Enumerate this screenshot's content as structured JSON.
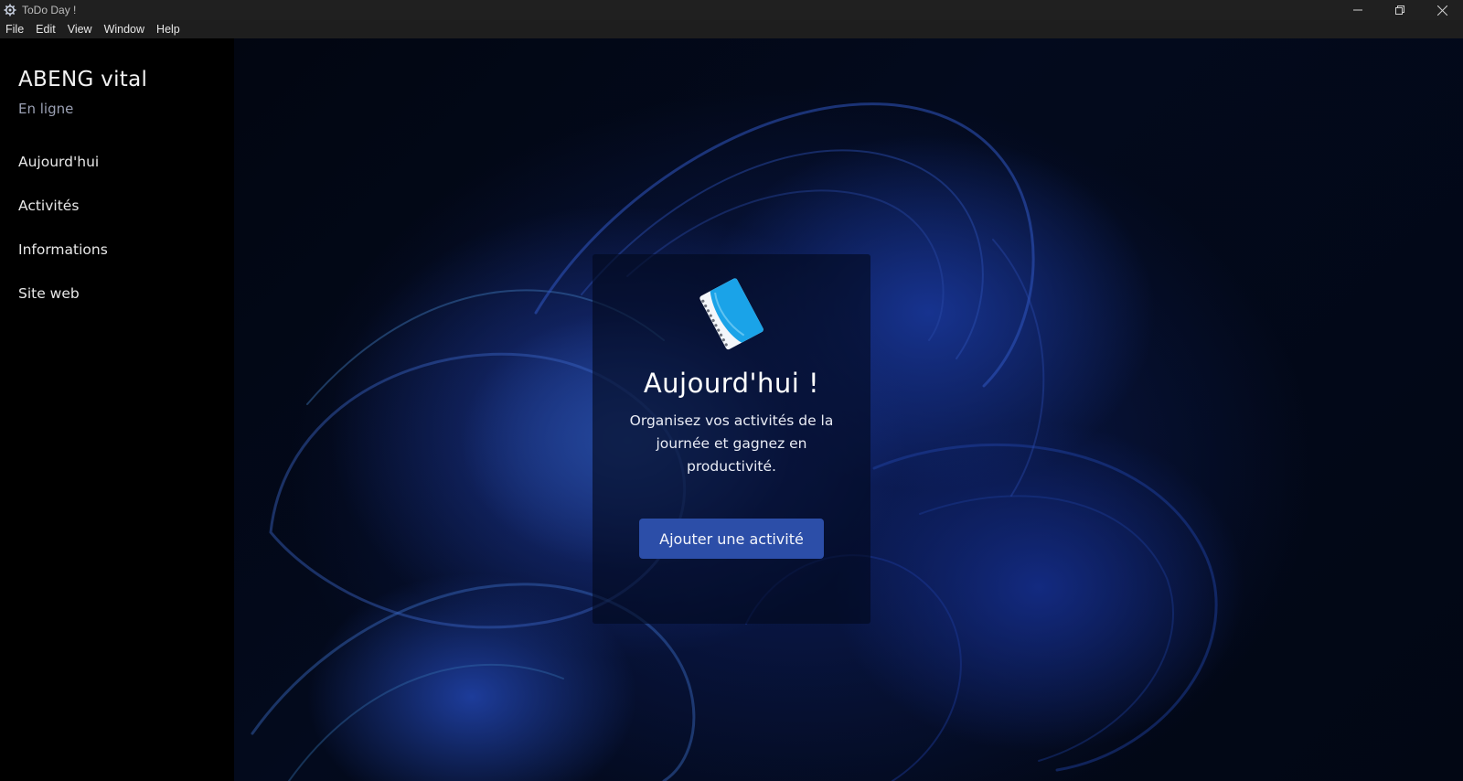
{
  "window": {
    "title": "ToDo Day !",
    "icon": "gear-app-icon",
    "controls": {
      "minimize": "—",
      "maximize": "❐",
      "close": "✕"
    }
  },
  "menu": {
    "items": [
      "File",
      "Edit",
      "View",
      "Window",
      "Help"
    ]
  },
  "sidebar": {
    "user_name": "ABENG vital",
    "user_status": "En ligne",
    "nav": [
      "Aujourd'hui",
      "Activités",
      "Informations",
      "Site web"
    ]
  },
  "hero": {
    "icon": "notebook-icon",
    "title": "Aujourd'hui !",
    "description": "Organisez vos activités de la journée et gagnez en productivité.",
    "button_label": "Ajouter une activité"
  },
  "colors": {
    "titlebar": "#202020",
    "sidebar": "#000000",
    "accent_button": "#2c4ea8",
    "status_text": "#9aa0b3"
  }
}
